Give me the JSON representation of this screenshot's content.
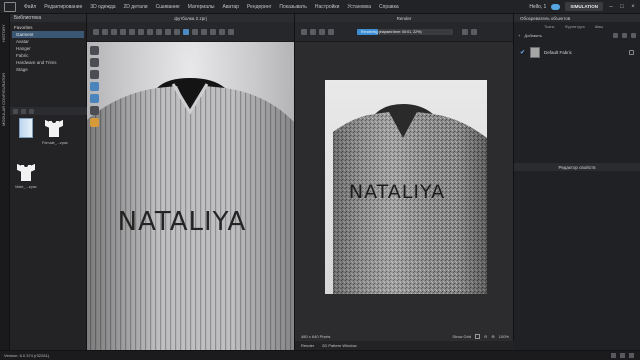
{
  "menubar": {
    "items": [
      "Файл",
      "Редактирование",
      "3D одежда",
      "2D детали",
      "Сшивание",
      "Материалы",
      "Аватар",
      "Рендеринг",
      "Показывать",
      "Настройки",
      "Установка",
      "Справка"
    ],
    "user": "Hello, 1",
    "simulation_label": "SIMULATION"
  },
  "vertical_tabs": [
    "HISTORY",
    "MODULAR CONFIGURATOR"
  ],
  "library": {
    "title": "Библиотека",
    "tree_root": "Favorites",
    "items": [
      "Garment",
      "Avatar",
      "Hanger",
      "Fabric",
      "Hardware and Trims",
      "Stage"
    ],
    "selected_index": 0,
    "thumbs": [
      {
        "caption": ""
      },
      {
        "caption": "Female_...zpac"
      },
      {
        "caption": "Male_...zpac"
      }
    ]
  },
  "viewport3d": {
    "tab_title": "футболка 2.zprj",
    "shirt_text": "NATALIYA"
  },
  "render": {
    "tab_title": "Render",
    "progress_text": "Rendering (elapsed time: 00:01, 22%)",
    "progress_fraction": 0.22,
    "shirt_text": "NATALIYA",
    "size_label": "480 x 640 Pixels",
    "show_grid_label": "Show Grid",
    "zoom_label": "100%",
    "bottom_tabs": [
      "Render",
      "2D Pattern Window"
    ]
  },
  "right_panel": {
    "title": "Обозреватель объектов",
    "tabs": [
      "Ткань",
      "Фурнитура",
      "Швы"
    ],
    "add_label": "Добавить",
    "fabric_item": "Default Fabric",
    "property_editor_title": "Редактор свойств"
  },
  "statusbar": {
    "version": "Version: 6.0.374 (r32261)"
  },
  "colors": {
    "accent": "#3c8fd6",
    "selection": "#3a5873",
    "panel": "#232325"
  }
}
